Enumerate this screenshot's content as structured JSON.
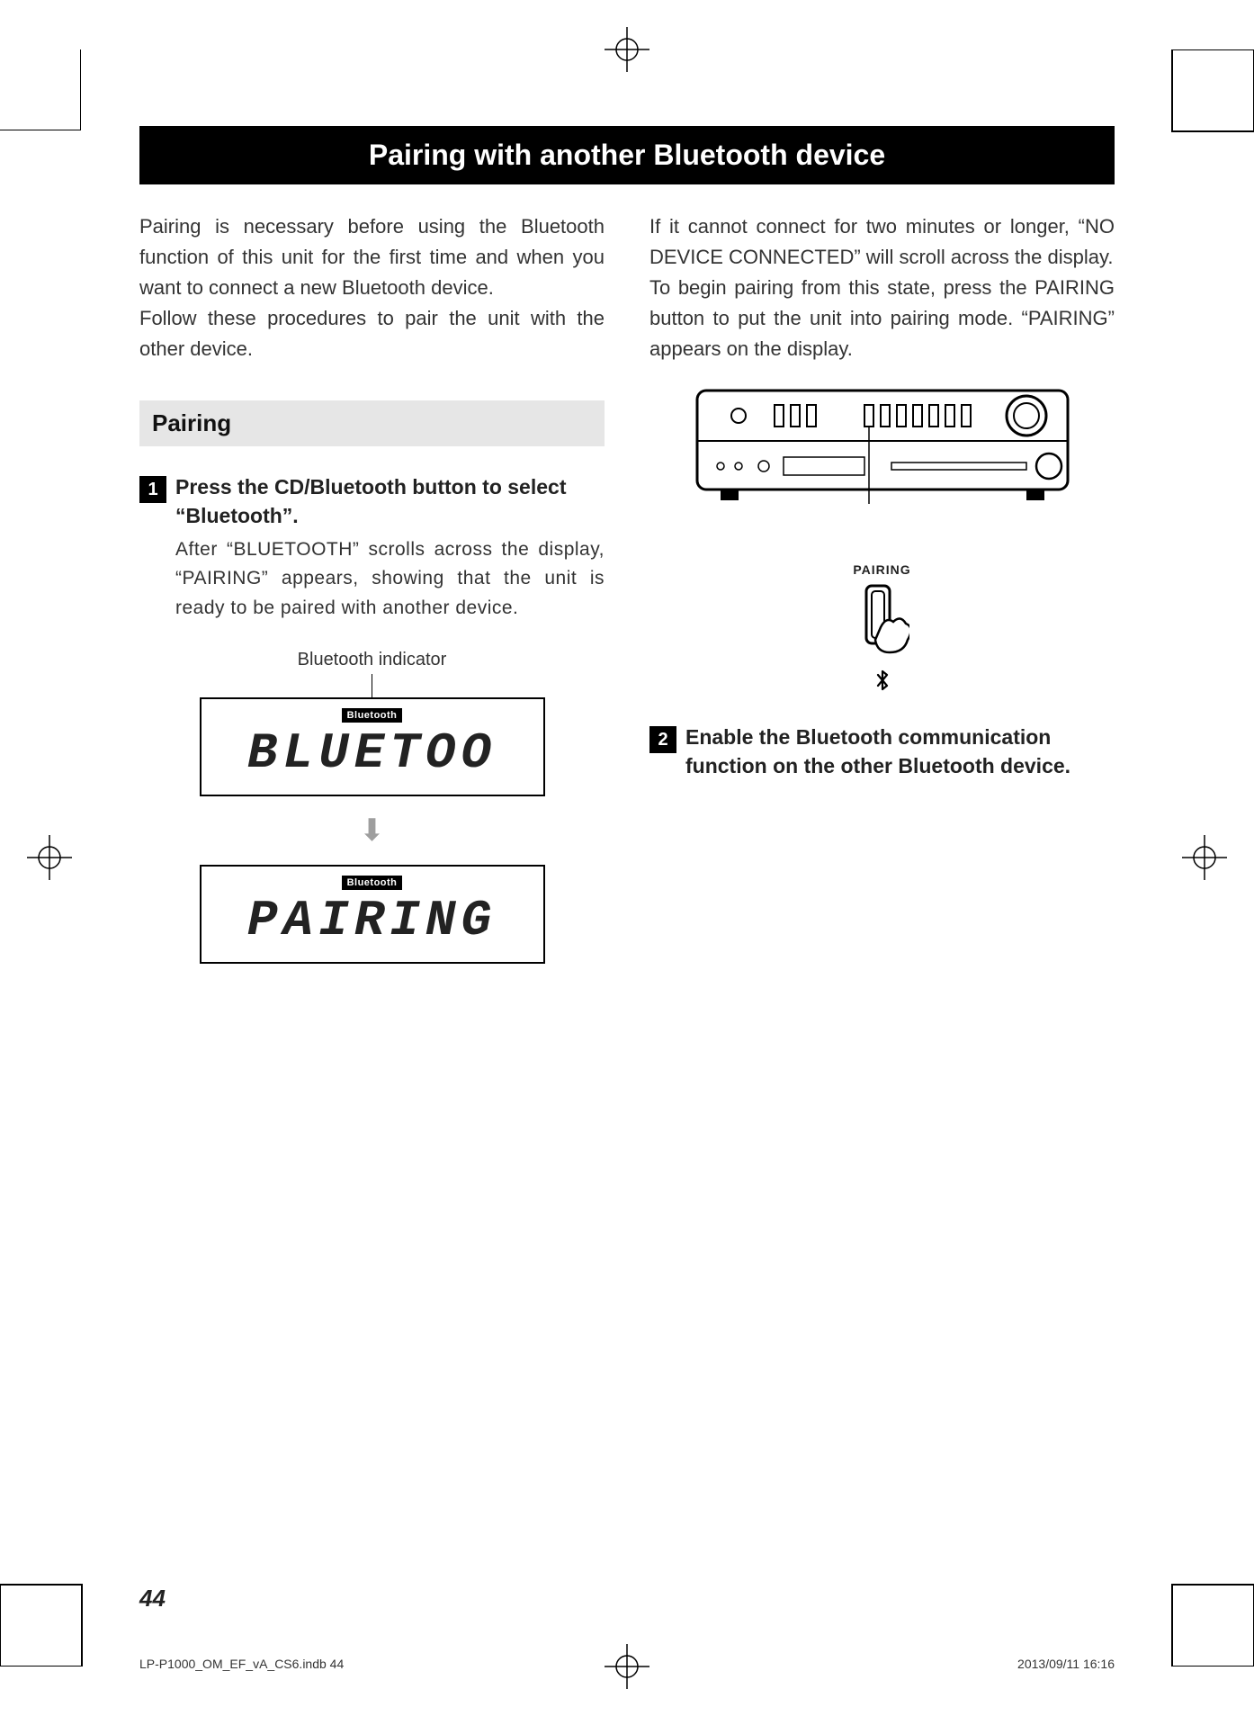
{
  "title": "Pairing with another Bluetooth device",
  "intro_left": "Pairing is necessary before using the Bluetooth function of this unit for the first time and when you want to connect a new Bluetooth device.\nFollow these procedures to pair the unit with the other device.",
  "section_heading": "Pairing",
  "step1": {
    "num": "1",
    "title": "Press the CD/Bluetooth button to select “Bluetooth”.",
    "body": "After “BLUETOOTH” scrolls across the display, “PAIRING” appears, showing that the unit is ready to be paired with another device."
  },
  "figure": {
    "caption": "Bluetooth indicator",
    "badge": "Bluetooth",
    "lcd1": "BLUETOO",
    "lcd2": "PAIRING"
  },
  "intro_right": "If it cannot connect for two minutes or longer, “NO DEVICE CONNECTED” will scroll across the display.\nTo begin pairing from this state, press the PAIRING button to put the unit into pairing mode. “PAIRING” appears on the display.",
  "pairing_label": "PAIRING",
  "step2": {
    "num": "2",
    "title": "Enable the Bluetooth communication function on the other Bluetooth device."
  },
  "page_number": "44",
  "footer_left": "LP-P1000_OM_EF_vA_CS6.indb   44",
  "footer_right": "2013/09/11   16:16"
}
